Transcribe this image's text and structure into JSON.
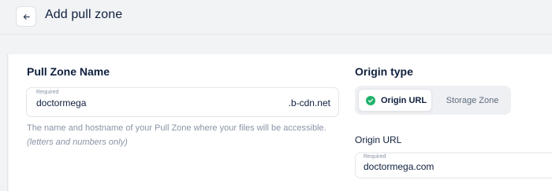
{
  "header": {
    "title": "Add pull zone"
  },
  "pull_zone": {
    "section_title": "Pull Zone Name",
    "required_label": "Required",
    "value": "doctormega",
    "suffix": ".b-cdn.net",
    "help_text": "The name and hostname of your Pull Zone where your files will be accessible.",
    "help_note": "(letters and numbers only)"
  },
  "origin_type": {
    "section_title": "Origin type",
    "options": [
      {
        "label": "Origin URL",
        "selected": true
      },
      {
        "label": "Storage Zone",
        "selected": false
      }
    ],
    "selected_icon": "check-circle-icon",
    "accent_color": "#21b36b"
  },
  "origin_url": {
    "label": "Origin URL",
    "required_label": "Required",
    "value": "doctormega.com"
  }
}
